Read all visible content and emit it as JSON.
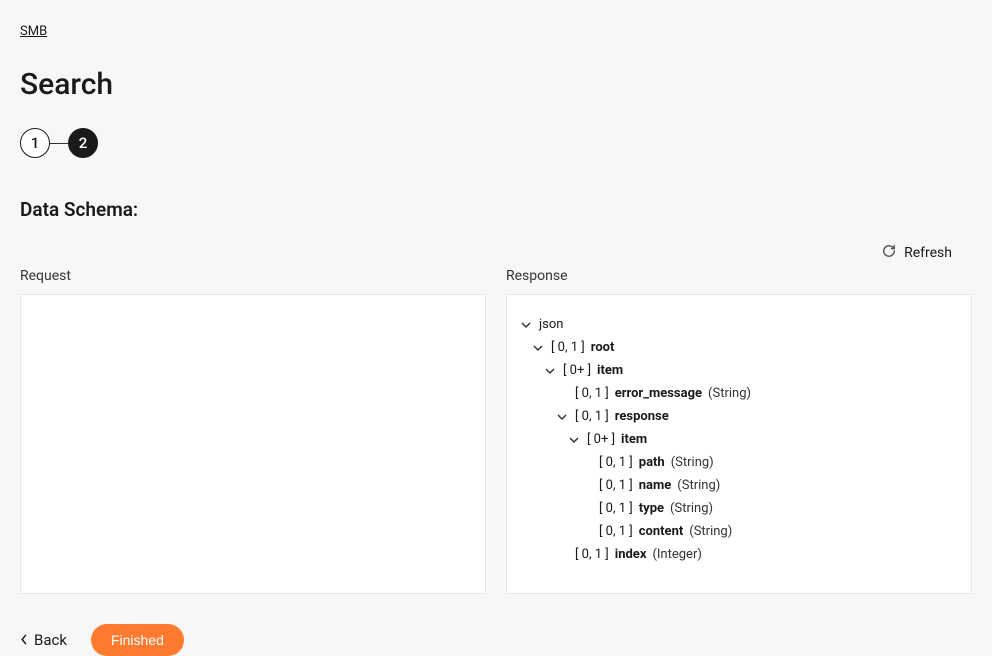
{
  "breadcrumb": "SMB",
  "title": "Search",
  "steps": {
    "s1": "1",
    "s2": "2"
  },
  "section_title": "Data Schema:",
  "refresh_label": "Refresh",
  "request_label": "Request",
  "response_label": "Response",
  "tree": {
    "json": "json",
    "root": {
      "card": "[ 0, 1 ]",
      "name": "root"
    },
    "item1": {
      "card": "[ 0+ ]",
      "name": "item"
    },
    "error_message": {
      "card": "[ 0, 1 ]",
      "name": "error_message",
      "type": "(String)"
    },
    "response": {
      "card": "[ 0, 1 ]",
      "name": "response"
    },
    "item2": {
      "card": "[ 0+ ]",
      "name": "item"
    },
    "path": {
      "card": "[ 0, 1 ]",
      "name": "path",
      "type": "(String)"
    },
    "name_field": {
      "card": "[ 0, 1 ]",
      "name": "name",
      "type": "(String)"
    },
    "type_field": {
      "card": "[ 0, 1 ]",
      "name": "type",
      "type": "(String)"
    },
    "content": {
      "card": "[ 0, 1 ]",
      "name": "content",
      "type": "(String)"
    },
    "index": {
      "card": "[ 0, 1 ]",
      "name": "index",
      "type": "(Integer)"
    }
  },
  "back_label": "Back",
  "finished_label": "Finished"
}
